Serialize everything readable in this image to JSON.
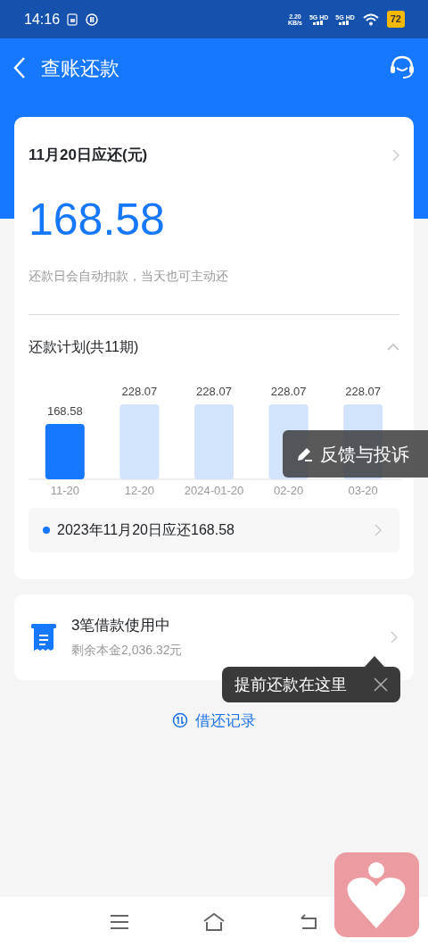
{
  "status_bar": {
    "time": "14:16",
    "speed": "2.20",
    "speed_unit": "KB/s",
    "sim_1": "5G HD",
    "sim_2": "5G HD",
    "battery": "72"
  },
  "header": {
    "title": "查账还款"
  },
  "due_card": {
    "title": "11月20日应还(元)",
    "amount": "168.58",
    "note": "还款日会自动扣款，当天也可主动还",
    "plan_title": "还款计划(共11期)",
    "expanded": true,
    "chart_data": {
      "type": "bar",
      "categories": [
        "11-20",
        "12-20",
        "2024-01-20",
        "02-20",
        "03-20"
      ],
      "values": [
        168.58,
        228.07,
        228.07,
        228.07,
        228.07
      ],
      "data_labels": true
    },
    "bars": [
      {
        "selected": true
      },
      {
        "selected": false
      },
      {
        "selected": false
      },
      {
        "selected": false
      },
      {
        "selected": false
      }
    ],
    "summary": "2023年11月20日应还168.58"
  },
  "loans": {
    "title": "3笔借款使用中",
    "subtitle": "剩余本金2,036.32元"
  },
  "tooltip": {
    "text": "提前还款在这里"
  },
  "history_link": "借还记录",
  "feedback_button": "反馈与投诉"
}
